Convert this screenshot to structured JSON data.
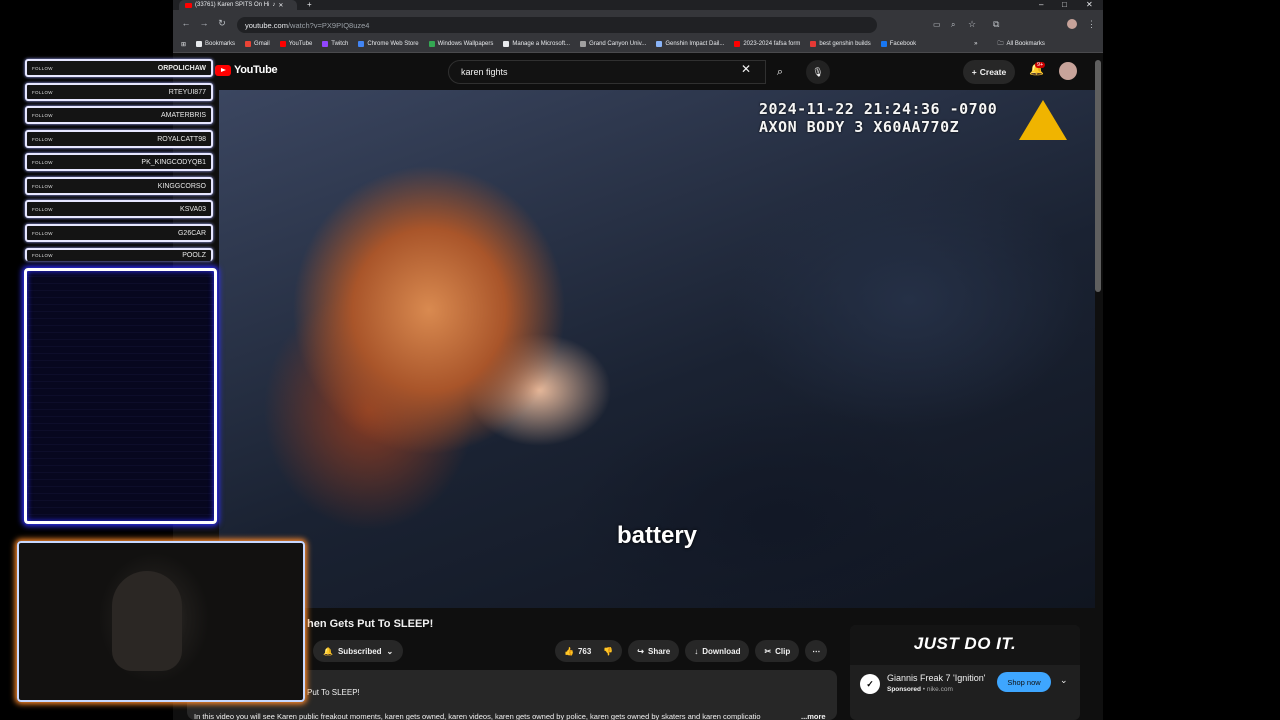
{
  "browser": {
    "tab_title": "(33761) Karen SPITS On Hi",
    "url_host": "youtube.com",
    "url_path": "/watch?v=PX9PIQ8uze4",
    "bookmarks": [
      "Bookmarks",
      "Gmail",
      "YouTube",
      "Twitch",
      "Chrome Web Store",
      "Windows Wallpapers",
      "Manage a Microsoft...",
      "Grand Canyon Univ...",
      "Genshin Impact Dail...",
      "2023-2024 fafsa form",
      "best genshin builds",
      "Facebook"
    ],
    "all_bookmarks": "All Bookmarks"
  },
  "youtube": {
    "logo": "YouTube",
    "search_query": "karen fights",
    "create_label": "Create",
    "notif_count": "9+",
    "video": {
      "timestamp_line1": "2024-11-22 21:24:36 -0700",
      "timestamp_line2": "AXON BODY 3 X60AA770Z",
      "caption": "battery"
    },
    "title": "hen Gets Put To SLEEP!",
    "subscribed_label": "Subscribed",
    "likes": "763",
    "share_label": "Share",
    "download_label": "Download",
    "clip_label": "Clip",
    "description_title": "Put To SLEEP!",
    "description_text": "In this video you will see Karen public freakout moments, karen gets owned, karen videos, karen gets owned by police, karen gets owned by skaters and karen complicatio",
    "description_more": "...more",
    "ad": {
      "banner": "JUST DO IT.",
      "title": "Giannis Freak 7 'Ignition'",
      "sponsored": "Sponsored",
      "domain": "nike.com",
      "shop_label": "Shop now"
    }
  },
  "overlay": {
    "follow_label": "FOLLOW",
    "followers": [
      "ORPOLICHAW",
      "RTEYUI877",
      "AMATERBRIS",
      "ROYALCATT98",
      "PK_KINGCODYQB1",
      "KINGGCORSO",
      "KSVA03",
      "G26CAR",
      "POOLZ"
    ]
  },
  "colors": {
    "youtube_red": "#ff0000",
    "shop_button": "#3ea6ff",
    "panel_glow": "#3030ff",
    "webcam_glow": "#ff8a2a"
  }
}
